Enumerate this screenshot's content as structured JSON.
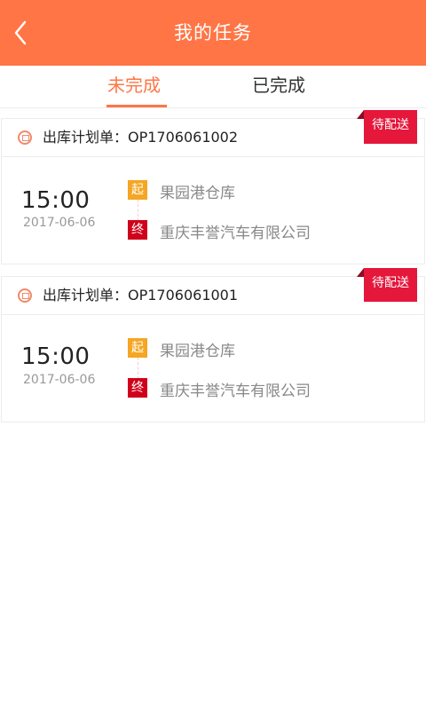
{
  "header": {
    "title": "我的任务",
    "back_icon": "chevron-left-icon"
  },
  "tabs": [
    {
      "label": "未完成",
      "active": true
    },
    {
      "label": "已完成",
      "active": false
    }
  ],
  "colors": {
    "accent": "#ff7545",
    "badge": "#e5173b",
    "start_tag": "#f5a623",
    "end_tag": "#d0021b"
  },
  "tasks": [
    {
      "order_label": "出库计划单：OP1706061002",
      "status": "待配送",
      "time": "15:00",
      "date": "2017-06-06",
      "start_tag": "起",
      "start_place": "果园港仓库",
      "end_tag": "终",
      "end_place": "重庆丰誉汽车有限公司"
    },
    {
      "order_label": "出库计划单：OP1706061001",
      "status": "待配送",
      "time": "15:00",
      "date": "2017-06-06",
      "start_tag": "起",
      "start_place": "果园港仓库",
      "end_tag": "终",
      "end_place": "重庆丰誉汽车有限公司"
    }
  ]
}
